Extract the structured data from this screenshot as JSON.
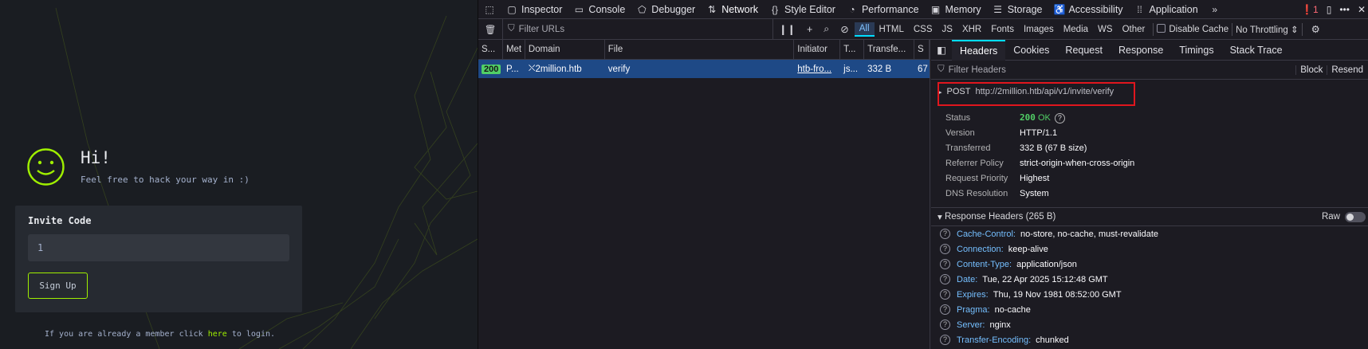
{
  "webpage": {
    "greeting": "Hi!",
    "tagline": "Feel free to hack your way in :)",
    "invite_label": "Invite Code",
    "invite_value": "1",
    "signup_label": "Sign Up",
    "login_prefix": "If you are already a member click ",
    "login_link": "here",
    "login_suffix": " to login."
  },
  "toolbar": {
    "tabs": [
      {
        "label": "Inspector",
        "icon": "inspector-icon"
      },
      {
        "label": "Console",
        "icon": "console-icon"
      },
      {
        "label": "Debugger",
        "icon": "debugger-icon"
      },
      {
        "label": "Network",
        "icon": "network-icon"
      },
      {
        "label": "Style Editor",
        "icon": "style-editor-icon"
      },
      {
        "label": "Performance",
        "icon": "performance-icon"
      },
      {
        "label": "Memory",
        "icon": "memory-icon"
      },
      {
        "label": "Storage",
        "icon": "storage-icon"
      },
      {
        "label": "Accessibility",
        "icon": "accessibility-icon"
      },
      {
        "label": "Application",
        "icon": "application-icon"
      }
    ],
    "error_count": "1"
  },
  "netbar": {
    "filter_placeholder": "Filter URLs",
    "types": [
      "All",
      "HTML",
      "CSS",
      "JS",
      "XHR",
      "Fonts",
      "Images",
      "Media",
      "WS",
      "Other"
    ],
    "disable_cache": "Disable Cache",
    "throttling": "No Throttling"
  },
  "requests": {
    "headers": [
      "S...",
      "Met",
      "Domain",
      "File",
      "Initiator",
      "T...",
      "Transfe...",
      "S"
    ],
    "rows": [
      {
        "status": "200",
        "method": "P...",
        "domain": "2million.htb",
        "file": "verify",
        "initiator": "htb-fro...",
        "type": "js...",
        "transferred": "332 B",
        "size": "67"
      }
    ]
  },
  "details": {
    "tabs": [
      "Headers",
      "Cookies",
      "Request",
      "Response",
      "Timings",
      "Stack Trace"
    ],
    "filter_placeholder": "Filter Headers",
    "block": "Block",
    "resend": "Resend",
    "method": "POST",
    "url": "http://2million.htb/api/v1/invite/verify",
    "info": [
      {
        "k": "Version",
        "v": "HTTP/1.1"
      },
      {
        "k": "Transferred",
        "v": "332 B (67 B size)"
      },
      {
        "k": "Referrer Policy",
        "v": "strict-origin-when-cross-origin"
      },
      {
        "k": "Request Priority",
        "v": "Highest"
      },
      {
        "k": "DNS Resolution",
        "v": "System"
      }
    ],
    "status_label": "Status",
    "status_code": "200",
    "status_text": "OK",
    "response_headers_title": "Response Headers (265 B)",
    "raw": "Raw",
    "response_headers": [
      {
        "k": "Cache-Control:",
        "v": "no-store, no-cache, must-revalidate"
      },
      {
        "k": "Connection:",
        "v": "keep-alive"
      },
      {
        "k": "Content-Type:",
        "v": "application/json"
      },
      {
        "k": "Date:",
        "v": "Tue, 22 Apr 2025 15:12:48 GMT"
      },
      {
        "k": "Expires:",
        "v": "Thu, 19 Nov 1981 08:52:00 GMT"
      },
      {
        "k": "Pragma:",
        "v": "no-cache"
      },
      {
        "k": "Server:",
        "v": "nginx"
      },
      {
        "k": "Transfer-Encoding:",
        "v": "chunked"
      }
    ]
  },
  "colors": {
    "accent": "#9fef00",
    "selected_row": "#1e4986",
    "status_ok": "#51cf66",
    "highlight_box": "#e0161e"
  }
}
